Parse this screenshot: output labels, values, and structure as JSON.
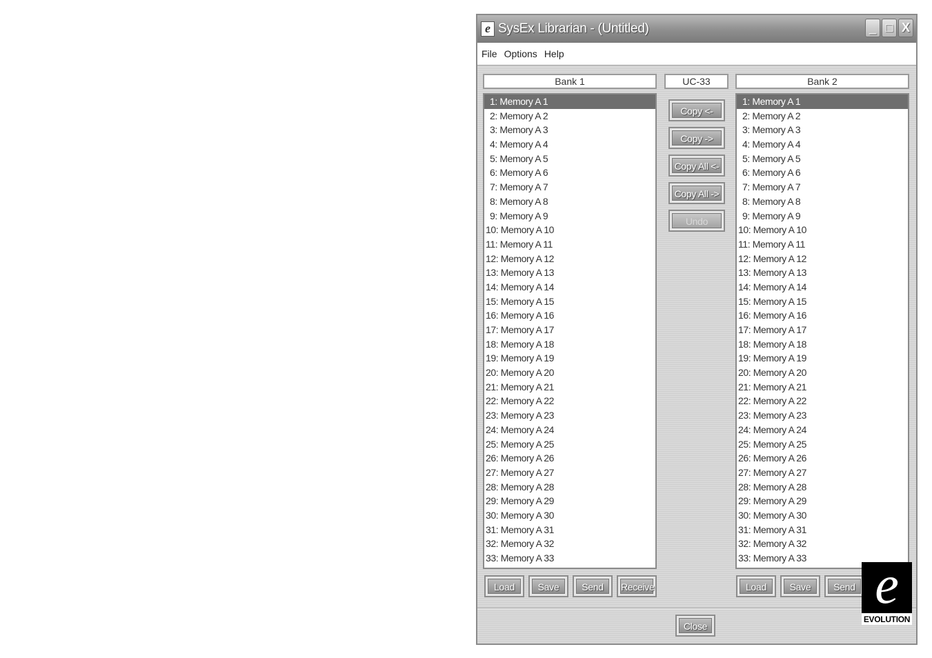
{
  "window": {
    "title": "SysEx Librarian - (Untitled)",
    "app_icon_glyph": "e",
    "controls": {
      "minimize": "_",
      "maximize": "□",
      "close": "X"
    }
  },
  "menu": [
    "File",
    "Options",
    "Help"
  ],
  "bank1": {
    "header": "Bank 1",
    "selected_index": 0,
    "items": [
      "1: Memory A 1",
      "2: Memory A 2",
      "3: Memory A 3",
      "4: Memory A 4",
      "5: Memory A 5",
      "6: Memory A 6",
      "7: Memory A 7",
      "8: Memory A 8",
      "9: Memory A 9",
      "10: Memory A 10",
      "11: Memory A 11",
      "12: Memory A 12",
      "13: Memory A 13",
      "14: Memory A 14",
      "15: Memory A 15",
      "16: Memory A 16",
      "17: Memory A 17",
      "18: Memory A 18",
      "19: Memory A 19",
      "20: Memory A 20",
      "21: Memory A 21",
      "22: Memory A 22",
      "23: Memory A 23",
      "24: Memory A 24",
      "25: Memory A 25",
      "26: Memory A 26",
      "27: Memory A 27",
      "28: Memory A 28",
      "29: Memory A 29",
      "30: Memory A 30",
      "31: Memory A 31",
      "32: Memory A 32",
      "33: Memory A 33"
    ],
    "buttons": {
      "load": "Load",
      "save": "Save",
      "send": "Send",
      "receive": "Receive"
    }
  },
  "device": {
    "label": "UC-33",
    "buttons": {
      "copy_left": "Copy <-",
      "copy_right": "Copy ->",
      "copy_all_left": "Copy All <-",
      "copy_all_right": "Copy All ->",
      "undo": "Undo"
    }
  },
  "bank2": {
    "header": "Bank 2",
    "selected_index": 0,
    "items": [
      "1: Memory A 1",
      "2: Memory A 2",
      "3: Memory A 3",
      "4: Memory A 4",
      "5: Memory A 5",
      "6: Memory A 6",
      "7: Memory A 7",
      "8: Memory A 8",
      "9: Memory A 9",
      "10: Memory A 10",
      "11: Memory A 11",
      "12: Memory A 12",
      "13: Memory A 13",
      "14: Memory A 14",
      "15: Memory A 15",
      "16: Memory A 16",
      "17: Memory A 17",
      "18: Memory A 18",
      "19: Memory A 19",
      "20: Memory A 20",
      "21: Memory A 21",
      "22: Memory A 22",
      "23: Memory A 23",
      "24: Memory A 24",
      "25: Memory A 25",
      "26: Memory A 26",
      "27: Memory A 27",
      "28: Memory A 28",
      "29: Memory A 29",
      "30: Memory A 30",
      "31: Memory A 31",
      "32: Memory A 32",
      "33: Memory A 33"
    ],
    "buttons": {
      "load": "Load",
      "save": "Save",
      "send": "Send"
    }
  },
  "footer": {
    "close": "Close"
  },
  "logo": {
    "glyph": "e",
    "text": "EVOLUTION"
  }
}
